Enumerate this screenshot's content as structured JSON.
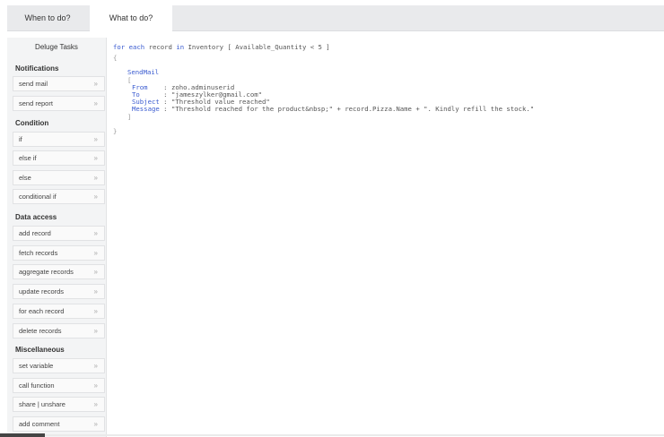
{
  "tabs": [
    {
      "label": "When to do?"
    },
    {
      "label": "What to do?",
      "active": true
    }
  ],
  "sidebar": {
    "title": "Deluge Tasks",
    "sections": [
      {
        "label": "Notifications",
        "items": [
          "send mail",
          "send report"
        ]
      },
      {
        "label": "Condition",
        "items": [
          "if",
          "else if",
          "else",
          "conditional if"
        ]
      },
      {
        "label": "Data access",
        "items": [
          "add record",
          "fetch records",
          "aggregate records",
          "update records",
          "for each record",
          "delete records"
        ]
      },
      {
        "label": "Miscellaneous",
        "items": [
          "set variable",
          "call function",
          "share | unshare",
          "add comment"
        ]
      }
    ],
    "chevron": "»"
  },
  "editor": {
    "for_kw": "for each",
    "record_var": "record",
    "in_kw": "in",
    "form": "Inventory",
    "criteria": "[ Available_Quantity < 5 ]",
    "open_brace": "{",
    "close_brace": "}",
    "task_name": "SendMail",
    "open_bracket": "[",
    "close_bracket": "]",
    "params": [
      {
        "key": "From   ",
        "value": ": zoho.adminuserid"
      },
      {
        "key": "To     ",
        "value": ": \"jameszylker@gmail.com\""
      },
      {
        "key": "Subject",
        "value": ": \"Threshold value reached\""
      },
      {
        "key": "Message",
        "value": ": \"Threshold reached for the product&nbsp;\" + record.Pizza.Name + \". Kindly refill the stock.\""
      }
    ]
  }
}
